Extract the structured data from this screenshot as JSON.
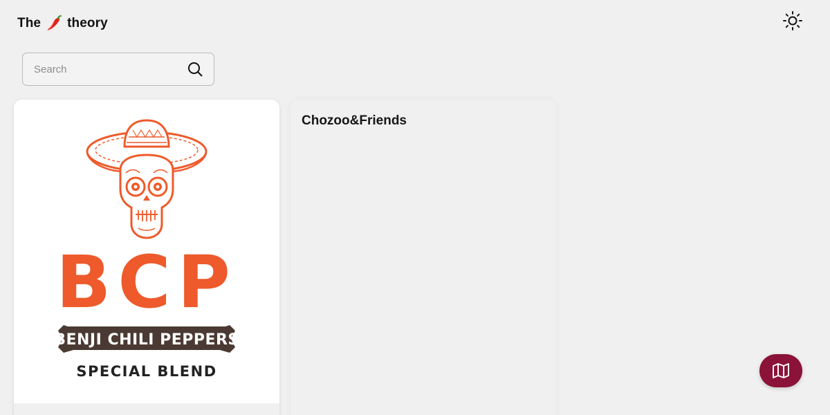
{
  "header": {
    "brand_prefix": "The",
    "brand_suffix": "theory",
    "brand_icon": "chili-pepper-icon",
    "theme_toggle_icon": "sun-icon"
  },
  "search": {
    "placeholder": "Search",
    "value": "",
    "icon": "search-icon"
  },
  "cards": [
    {
      "title": "",
      "logo": {
        "icon": "sombrero-skull-icon",
        "letters": "BCP",
        "banner": "BENJI CHILI PEPPERS",
        "subtitle": "SPECIAL BLEND"
      }
    },
    {
      "title": "Chozoo&Friends"
    }
  ],
  "map_button": {
    "icon": "map-icon"
  },
  "colors": {
    "background": "#f0f0f0",
    "logo_orange": "#ee5a2b",
    "banner_brown": "#4a3a33",
    "map_button": "#8b1238"
  }
}
